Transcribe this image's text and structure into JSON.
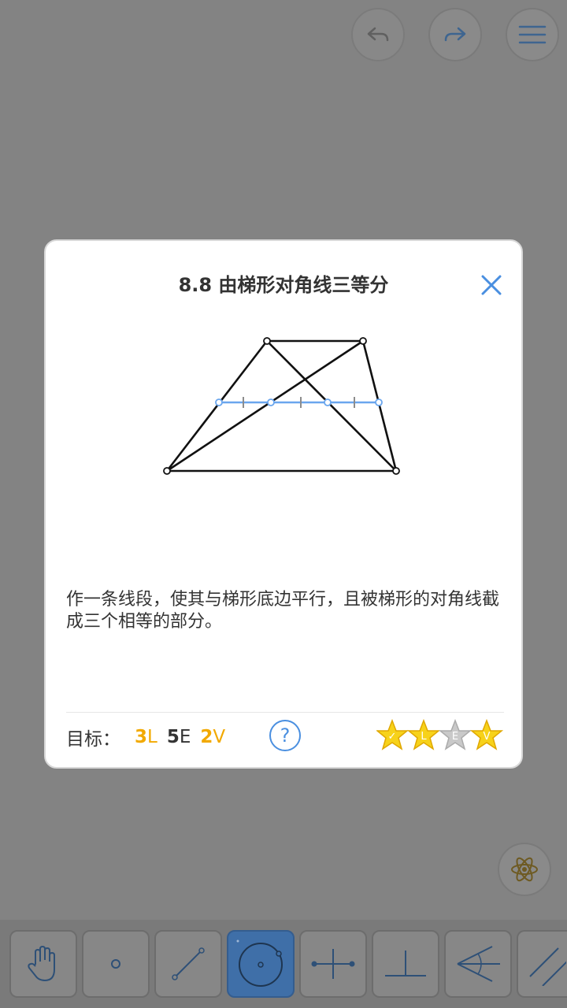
{
  "dialog": {
    "title": "8.8 由梯形对角线三等分",
    "description": "作一条线段，使其与梯形底边平行，且被梯形的对角线截成三个相等的部分。",
    "goal_label": "目标：",
    "goals": [
      {
        "count": "3",
        "unit": "L",
        "color": "gold"
      },
      {
        "count": "5",
        "unit": "E",
        "color": "dark"
      },
      {
        "count": "2",
        "unit": "V",
        "color": "gold"
      }
    ],
    "help_symbol": "?",
    "stars": [
      {
        "letter": "✓",
        "earned": true
      },
      {
        "letter": "L",
        "earned": true
      },
      {
        "letter": "E",
        "earned": false
      },
      {
        "letter": "V",
        "earned": true
      }
    ]
  },
  "colors": {
    "accent": "#4a8fe0",
    "gold": "#f2a900",
    "overlay": "#000000"
  },
  "icons": [
    "undo-icon",
    "redo-icon",
    "menu-icon",
    "close-icon",
    "help-icon",
    "atom-hint-icon",
    "hand-tool-icon",
    "point-tool-icon",
    "line-tool-icon",
    "circle-tool-icon",
    "perpendicular-bisector-tool-icon",
    "perpendicular-tool-icon",
    "angle-bisector-tool-icon",
    "parallel-tool-icon"
  ]
}
